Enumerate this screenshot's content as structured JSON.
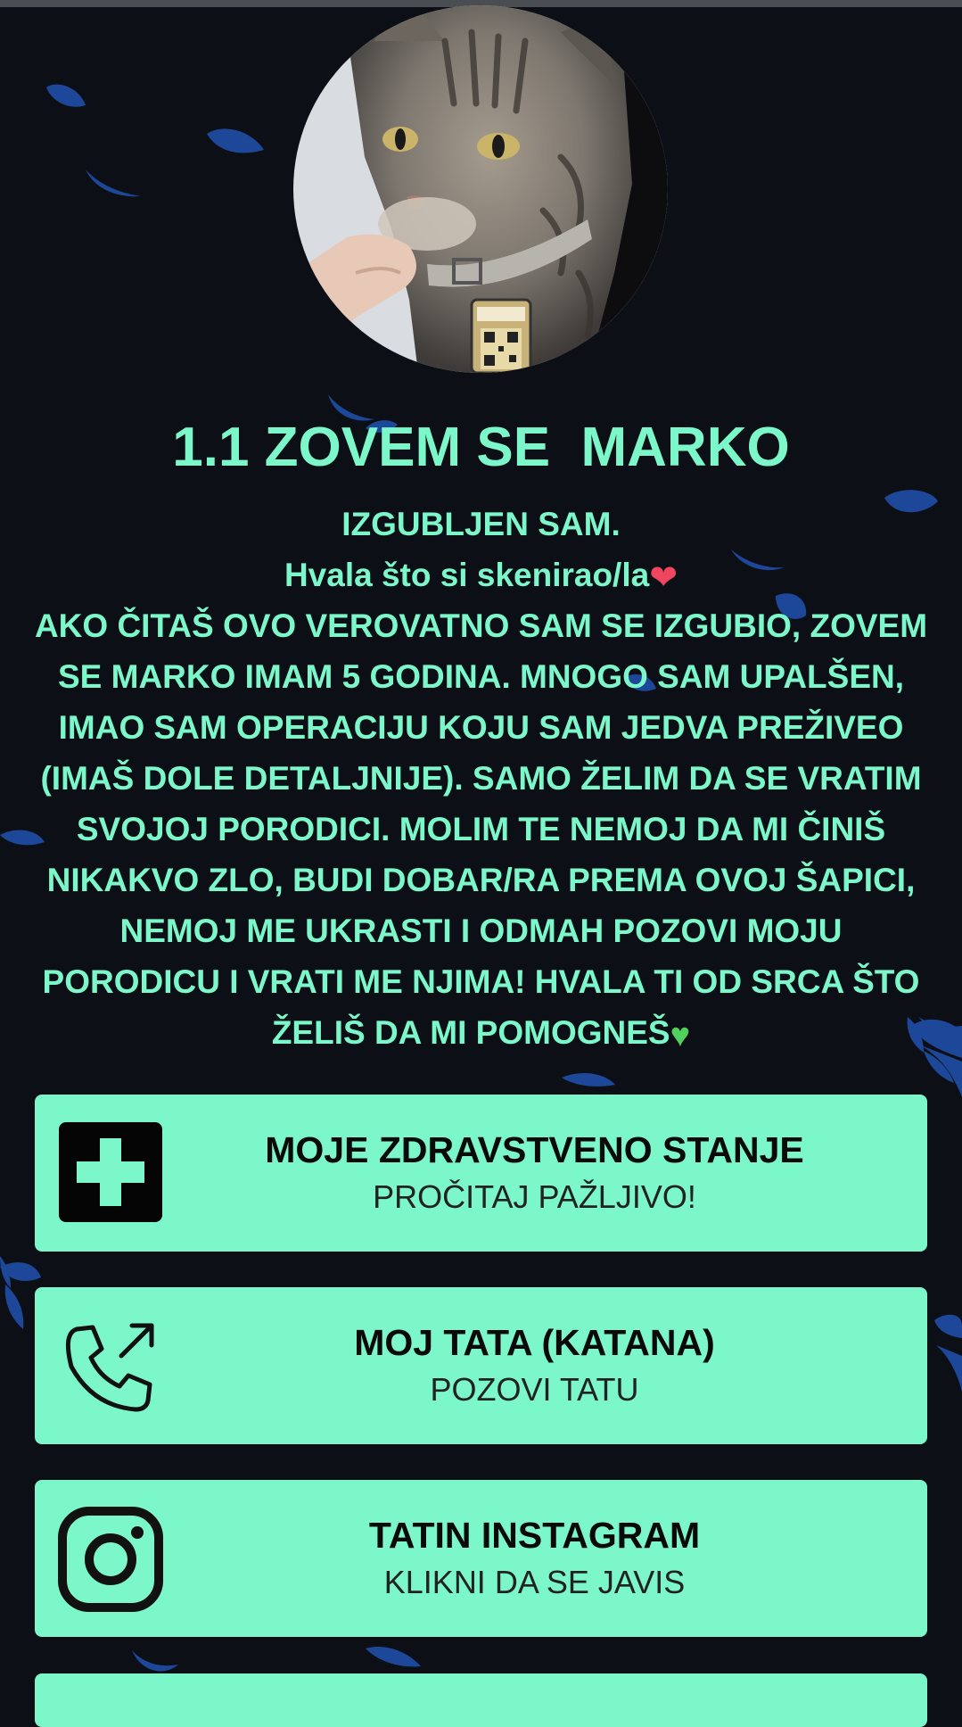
{
  "profile": {
    "avatar_alt": "",
    "title": "1.1 ZOVEM SE  MARKO",
    "bio": {
      "line1": "IZGUBLJEN SAM.",
      "line2": "Hvala što si skenirao/la",
      "line2_emoji": "❤",
      "line3": "AKO ČITAŠ OVO VEROVATNO SAM SE IZGUBIO, ZOVEM SE MARKO IMAM 5 GODINA. MNOGO SAM UPALŠEN, IMAO SAM OPERACIJU KOJU SAM JEDVA PREŽIVEO (IMAŠ DOLE DETALJNIJE). SAMO ŽELIM DA SE VRATIM SVOJOJ PORODICI. MOLIM TE NEMOJ DA MI ČINIŠ NIKAKVO ZLO, BUDI DOBAR/RA PREMA OVOJ ŠAPICI, NEMOJ ME UKRASTI I ODMAH POZOVI MOJU PORODICU I VRATI ME NJIMA! HVALA TI OD SRCA ŠTO ŽELIŠ DA MI POMOGNEŠ",
      "line3_emoji": "♥"
    }
  },
  "links": [
    {
      "title": "MOJE ZDRAVSTVENO STANJE",
      "subtitle": "PROČITAJ PAŽLJIVO!",
      "icon": "medical-cross-icon"
    },
    {
      "title": "MOJ TATA (KATANA)",
      "subtitle": "POZOVI TATU",
      "icon": "phone-outgoing-icon"
    },
    {
      "title": "TATIN INSTAGRAM",
      "subtitle": "KLIKNI DA SE JAVIS",
      "icon": "instagram-icon"
    }
  ],
  "colors": {
    "background": "#0c0f15",
    "accent": "#7bf7c9",
    "petal": "#1f4fa8",
    "button_text": "#0a0a0a"
  }
}
